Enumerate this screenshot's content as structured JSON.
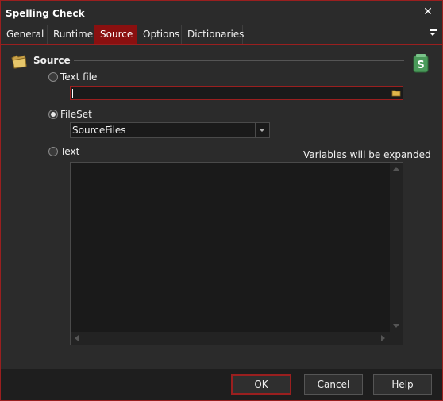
{
  "window": {
    "title": "Spelling Check"
  },
  "tabs": [
    {
      "label": "General"
    },
    {
      "label": "Runtime"
    },
    {
      "label": "Source"
    },
    {
      "label": "Options"
    },
    {
      "label": "Dictionaries"
    }
  ],
  "active_tab": "Source",
  "section": {
    "title": "Source"
  },
  "options": {
    "text_file": {
      "label": "Text file",
      "value": ""
    },
    "fileset": {
      "label": "FileSet",
      "value": "SourceFiles"
    },
    "text": {
      "label": "Text",
      "value": ""
    }
  },
  "selected_option": "FileSet",
  "hint": "Variables will be expanded",
  "buttons": {
    "ok": "OK",
    "cancel": "Cancel",
    "help": "Help"
  },
  "colors": {
    "accent": "#9a1f1f",
    "active_tab": "#8a1010",
    "background": "#2b2b2b"
  },
  "icons": [
    "close-icon",
    "menu-icon",
    "folder-icon",
    "script-icon",
    "browse-folder-icon",
    "dropdown-arrow-icon"
  ]
}
